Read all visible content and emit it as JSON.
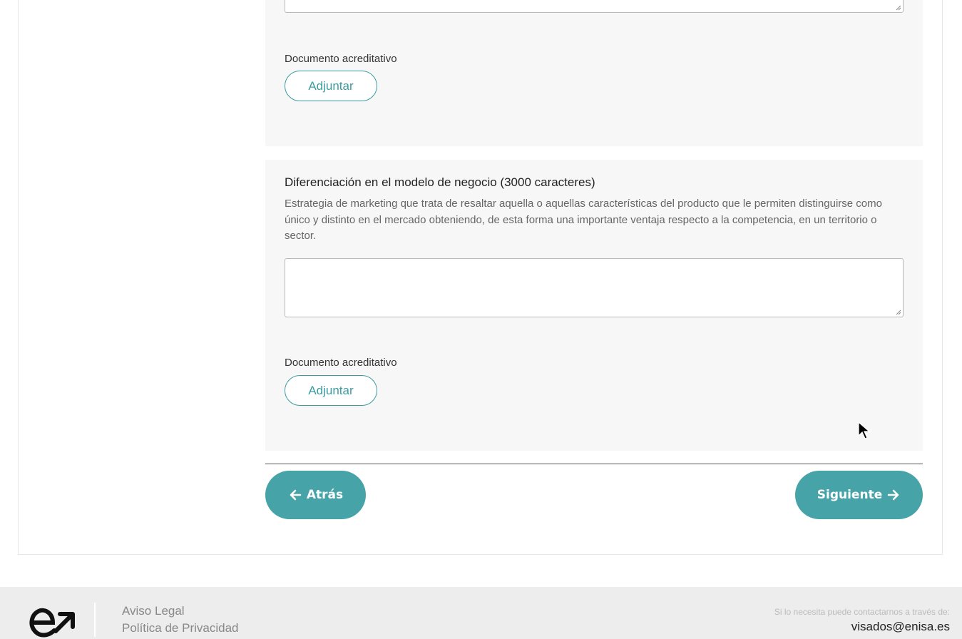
{
  "sections": [
    {
      "doc_label": "Documento acreditativo",
      "attach_label": "Adjuntar",
      "textarea_value": ""
    },
    {
      "title": "Diferenciación en el modelo de negocio (3000 caracteres)",
      "description": "Estrategia de marketing que trata de resaltar aquella o aquellas características del producto que le permiten distinguirse como único y distinto en el mercado obteniendo, de esta forma una importante ventaja respecto a la competencia, en un territorio o sector.",
      "textarea_value": "",
      "doc_label": "Documento acreditativo",
      "attach_label": "Adjuntar"
    }
  ],
  "navigation": {
    "back_label": "Atrás",
    "next_label": "Siguiente"
  },
  "footer": {
    "links": [
      "Aviso Legal",
      "Política de Privacidad"
    ],
    "contact_note": "Si lo necesita puede contactarnos a través de:",
    "contact_email": "visados@enisa.es"
  },
  "colors": {
    "accent": "#46a3a7",
    "accent_border": "#3b9ca0",
    "section_bg": "#f7f7f7",
    "footer_bg": "#ededed"
  },
  "icons": [
    "arrow-left-icon",
    "arrow-right-icon",
    "resize-grip-icon",
    "enisa-logo",
    "mouse-cursor-icon"
  ]
}
